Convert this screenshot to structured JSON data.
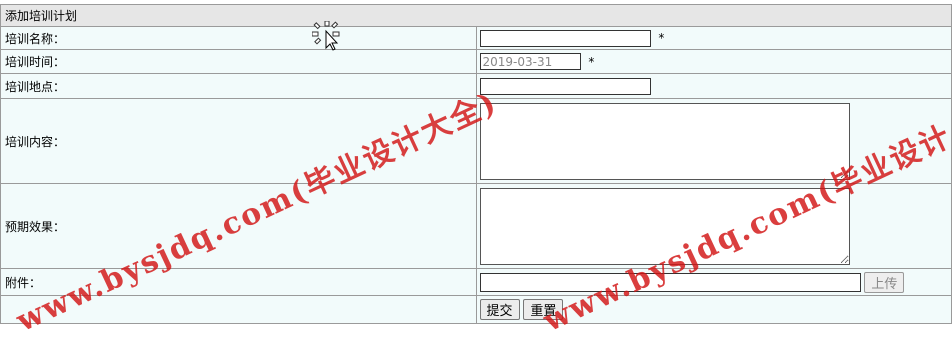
{
  "form": {
    "title": "添加培训计划",
    "required_mark": "*",
    "fields": {
      "name": {
        "label": "培训名称：",
        "value": ""
      },
      "time": {
        "label": "培训时间：",
        "value": "2019-03-31"
      },
      "place": {
        "label": "培训地点：",
        "value": ""
      },
      "content": {
        "label": "培训内容：",
        "value": ""
      },
      "effect": {
        "label": "预期效果：",
        "value": ""
      },
      "attachment": {
        "label": "附件：",
        "value": "",
        "upload_label": "上传"
      }
    },
    "buttons": {
      "submit": "提交",
      "reset": "重置"
    }
  },
  "watermark": {
    "text": "www.bysjdq.com(毕业设计大全)",
    "text_partial": "www.bysjdq.com(毕业设计",
    "color": "#d21414"
  }
}
